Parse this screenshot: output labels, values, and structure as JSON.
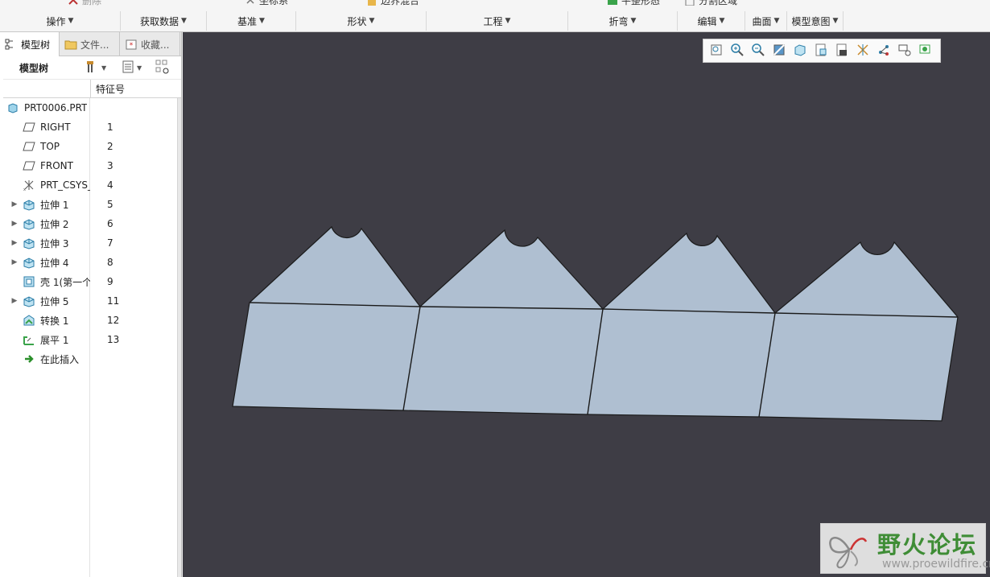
{
  "ribbon": {
    "top_partial": [
      "删除",
      "坐标系",
      "边界混合",
      "平整形态",
      "分割区域"
    ],
    "groups": [
      {
        "label": "操作",
        "icon": "caret-down-icon"
      },
      {
        "label": "获取数据",
        "icon": "caret-down-icon"
      },
      {
        "label": "基准",
        "icon": "caret-down-icon"
      },
      {
        "label": "形状",
        "icon": "caret-down-icon"
      },
      {
        "label": "工程",
        "icon": "caret-down-icon"
      },
      {
        "label": "折弯",
        "icon": "caret-down-icon"
      },
      {
        "label": "编辑",
        "icon": "caret-down-icon"
      },
      {
        "label": "曲面",
        "icon": "caret-down-icon"
      },
      {
        "label": "模型意图",
        "icon": "caret-down-icon"
      }
    ]
  },
  "left_panel": {
    "tabs": [
      {
        "label": "模型树",
        "icon": "model-tree-icon",
        "active": true
      },
      {
        "label": "文件...",
        "icon": "folder-icon",
        "active": false
      },
      {
        "label": "收藏...",
        "icon": "favorites-icon",
        "active": false
      }
    ],
    "toolbar_title": "模型树",
    "column_header": "特征号",
    "tree": [
      {
        "label": "PRT0006.PRT",
        "num": "",
        "icon": "part-icon",
        "expandable": false,
        "level": 0
      },
      {
        "label": "RIGHT",
        "num": "1",
        "icon": "datum-plane-icon",
        "expandable": false,
        "level": 1
      },
      {
        "label": "TOP",
        "num": "2",
        "icon": "datum-plane-icon",
        "expandable": false,
        "level": 1
      },
      {
        "label": "FRONT",
        "num": "3",
        "icon": "datum-plane-icon",
        "expandable": false,
        "level": 1
      },
      {
        "label": "PRT_CSYS_",
        "num": "4",
        "icon": "coordinate-system-icon",
        "expandable": false,
        "level": 1
      },
      {
        "label": "拉伸 1",
        "num": "5",
        "icon": "extrude-icon",
        "expandable": true,
        "level": 1
      },
      {
        "label": "拉伸 2",
        "num": "6",
        "icon": "extrude-icon",
        "expandable": true,
        "level": 1
      },
      {
        "label": "拉伸 3",
        "num": "7",
        "icon": "extrude-icon",
        "expandable": true,
        "level": 1
      },
      {
        "label": "拉伸 4",
        "num": "8",
        "icon": "extrude-icon",
        "expandable": true,
        "level": 1
      },
      {
        "label": "壳 1(第一个",
        "num": "9",
        "icon": "shell-icon",
        "expandable": false,
        "level": 1
      },
      {
        "label": "拉伸 5",
        "num": "11",
        "icon": "extrude-icon",
        "expandable": true,
        "level": 1
      },
      {
        "label": "转换 1",
        "num": "12",
        "icon": "convert-icon",
        "expandable": false,
        "level": 1
      },
      {
        "label": "展平 1",
        "num": "13",
        "icon": "unbend-icon",
        "expandable": false,
        "level": 1
      },
      {
        "label": "在此插入",
        "num": "",
        "icon": "insert-here-icon",
        "expandable": false,
        "level": 1
      }
    ]
  },
  "view_toolbar": [
    "refit-icon",
    "zoom-in-icon",
    "zoom-out-icon",
    "repaint-icon",
    "display-style-icon",
    "saved-orientations-icon",
    "view-manager-icon",
    "datum-display-icon",
    "spin-center-icon",
    "annotation-display-icon",
    "appearance-icon"
  ],
  "watermark": {
    "title": "野火论坛",
    "url": "www.proewildfire.cn",
    "colors": {
      "title": "#3f8d36",
      "url": "#9a9a9a"
    }
  },
  "colors": {
    "viewport_bg": "#3e3d45",
    "sheet_fill": "#afbfd1",
    "sheet_edge": "#1a1a1a"
  }
}
